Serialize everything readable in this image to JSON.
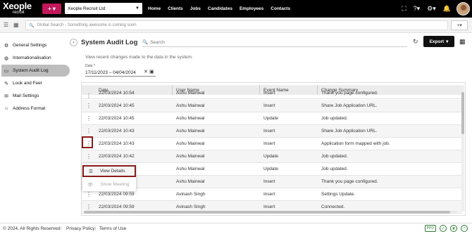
{
  "brand": {
    "name": "Xeople",
    "sub": "recruit"
  },
  "header": {
    "plus_label": "+",
    "company": "Xeople Recruit Ltd",
    "nav": [
      "Home",
      "Clients",
      "Jobs",
      "Candidates",
      "Employees",
      "Contacts"
    ]
  },
  "search": {
    "placeholder": "Global Search - Something awesome is coming soon",
    "add_label": "+"
  },
  "sidebar": {
    "items": [
      {
        "label": "General Settings",
        "icon": "gear-icon"
      },
      {
        "label": "Internationalisation",
        "icon": "globe-icon"
      },
      {
        "label": "System Audit Log",
        "icon": "monitor-icon",
        "active": true
      },
      {
        "label": "Look and Feel",
        "icon": "brush-icon"
      },
      {
        "label": "Mail Settings",
        "icon": "mail-icon"
      },
      {
        "label": "Address Format",
        "icon": "home-icon"
      }
    ]
  },
  "page": {
    "title": "System Audit Log",
    "search_placeholder": "Search",
    "export_label": "Export",
    "description": "View recent changes made to the data in the system.",
    "date_label": "Date *",
    "date_value": "17/11/2023 – 04/04/2024"
  },
  "table": {
    "columns": [
      "Date",
      "User Name",
      "Event Name",
      "Change Summary"
    ],
    "rows": [
      [
        "22/03/2024 10:54",
        "Ashu Mainwal",
        "Insert",
        "Thank you page configured."
      ],
      [
        "22/03/2024 10:45",
        "Ashu Mainwal",
        "Insert",
        "Share Job Application URL."
      ],
      [
        "22/03/2024 10:45",
        "Ashu Mainwal",
        "Update",
        "Job updated."
      ],
      [
        "22/03/2024 10:43",
        "Ashu Mainwal",
        "Insert",
        "Share Job Application URL."
      ],
      [
        "22/03/2024 10:43",
        "Ashu Mainwal",
        "Insert",
        "Application form mapped with job."
      ],
      [
        "22/03/2024 10:42",
        "Ashu Mainwal",
        "Update",
        "Job updated."
      ],
      [
        "",
        "Ashu Mainwal",
        "Update",
        "Job updated."
      ],
      [
        "",
        "Ashu Mainwal",
        "Insert",
        "Thank you page configured."
      ],
      [
        "22/03/2024 09:59",
        "Avinash Singh",
        "Insert",
        "Settings Update."
      ],
      [
        "22/03/2024 09:59",
        "Avinash Singh",
        "Insert",
        "Connected."
      ]
    ]
  },
  "context_menu": {
    "items": [
      "View Details",
      "Show Meeting"
    ]
  },
  "footer": {
    "copyright": "© 2024. All Rights Reserved",
    "privacy": "Privacy Policy",
    "terms": "Terms of Use",
    "badge": "PPD"
  },
  "colors": {
    "accent": "#c2185b",
    "highlight": "#8b1a1a",
    "nav_bg": "#000000"
  }
}
